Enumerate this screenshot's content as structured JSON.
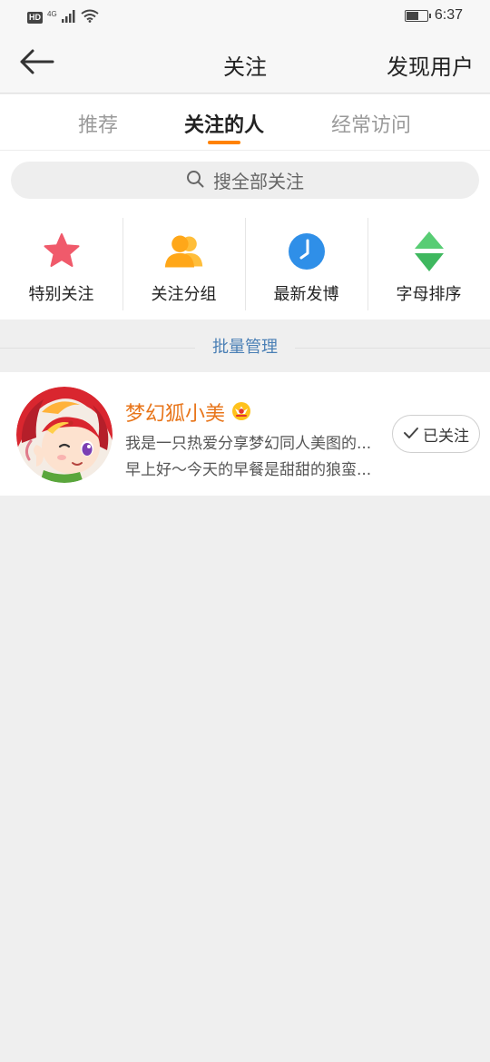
{
  "status_bar": {
    "hd": "HD",
    "network": "4G",
    "time": "6:37",
    "battery_level": 0.55
  },
  "nav": {
    "title": "关注",
    "right_action": "发现用户"
  },
  "tabs": [
    {
      "label": "推荐",
      "active": false
    },
    {
      "label": "关注的人",
      "active": true
    },
    {
      "label": "经常访问",
      "active": false
    }
  ],
  "search": {
    "placeholder": "搜全部关注"
  },
  "shortcuts": [
    {
      "label": "特别关注",
      "icon": "star-icon",
      "color": "#f05a6b"
    },
    {
      "label": "关注分组",
      "icon": "group-icon",
      "color": "#ffa719"
    },
    {
      "label": "最新发博",
      "icon": "clock-icon",
      "color": "#2f8fe8"
    },
    {
      "label": "字母排序",
      "icon": "sort-icon",
      "color": "#4fc46c"
    }
  ],
  "batch_manage": "批量管理",
  "users": [
    {
      "name": "梦幻狐小美",
      "badge_icon": "vip-crown-icon",
      "bio": "我是一只热爱分享梦幻同人美图的...",
      "latest": "早上好～今天的早餐是甜甜的狼蛮...",
      "follow_label": "已关注"
    }
  ],
  "colors": {
    "accent": "#ff8200",
    "name": "#e8751a",
    "link": "#4a7fb5"
  }
}
